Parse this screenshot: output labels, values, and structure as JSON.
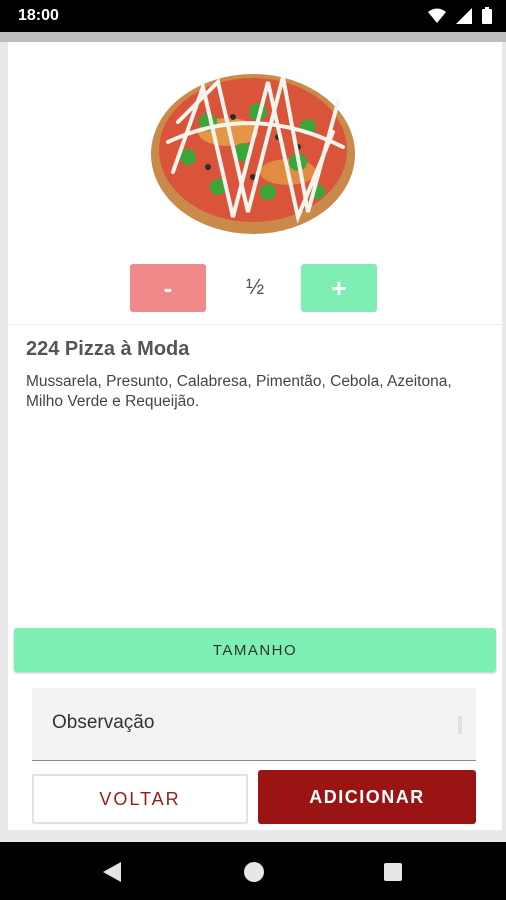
{
  "status": {
    "time": "18:00"
  },
  "product": {
    "quantity": "½",
    "minus_label": "-",
    "plus_label": "+",
    "title": "224 Pizza à Moda",
    "description": "Mussarela, Presunto, Calabresa, Pimentão, Cebola, Azeitona, Milho Verde e Requeijão."
  },
  "size_button": {
    "label": "TAMANHO"
  },
  "observation": {
    "label": "Observação"
  },
  "actions": {
    "back_label": "VOLTAR",
    "add_label": "ADICIONAR"
  },
  "colors": {
    "minus": "#f08a8a",
    "plus": "#7eeeb3",
    "size_button": "#7ff0b4",
    "add_button": "#9b1414",
    "back_text": "#9b1b1b"
  }
}
